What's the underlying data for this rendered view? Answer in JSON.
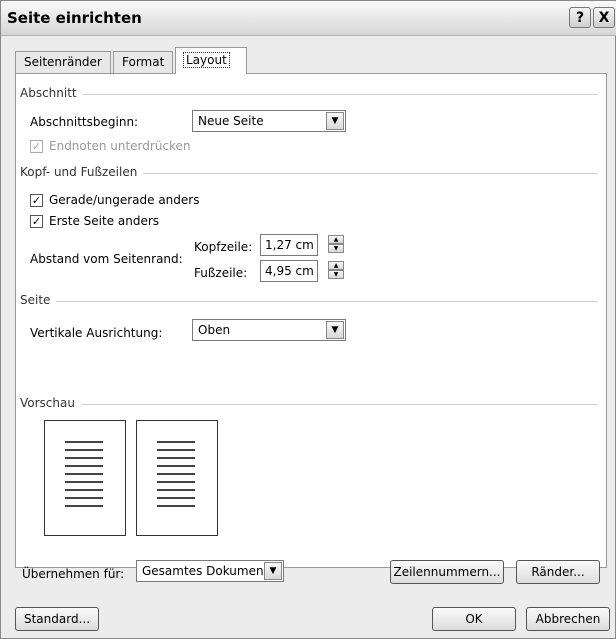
{
  "dialog": {
    "title": "Seite einrichten",
    "help_label": "?",
    "close_label": "X"
  },
  "tabs": [
    {
      "label": "Seitenränder"
    },
    {
      "label": "Format"
    },
    {
      "label": "Layout"
    }
  ],
  "section": {
    "heading": "Abschnitt",
    "start_label": "Abschnittsbeginn:",
    "start_value": "Neue Seite",
    "suppress_endnotes": "Endnoten unterdrücken",
    "suppress_endnotes_checked": true,
    "suppress_endnotes_enabled": false
  },
  "headers": {
    "heading": "Kopf- und Fußzeilen",
    "odd_even": "Gerade/ungerade anders",
    "odd_even_checked": true,
    "first_page": "Erste Seite anders",
    "first_page_checked": true,
    "distance_label": "Abstand vom Seitenrand:",
    "header_label": "Kopfzeile:",
    "header_value": "1,27 cm",
    "footer_label": "Fußzeile:",
    "footer_value": "4,95 cm"
  },
  "page": {
    "heading": "Seite",
    "valign_label": "Vertikale Ausrichtung:",
    "valign_value": "Oben"
  },
  "preview": {
    "heading": "Vorschau"
  },
  "apply": {
    "label": "Übernehmen für:",
    "value": "Gesamtes Dokument"
  },
  "buttons": {
    "line_numbers": "Zeilennummern...",
    "borders": "Ränder...",
    "default": "Standard...",
    "ok": "OK",
    "cancel": "Abbrechen"
  }
}
